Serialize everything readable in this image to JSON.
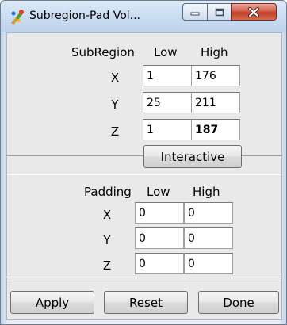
{
  "window": {
    "title": "Subregion-Pad Vol...",
    "controls": {
      "minimize": "minimize",
      "maximize": "maximize",
      "close": "close"
    }
  },
  "subregion": {
    "heading": "SubRegion",
    "low_label": "Low",
    "high_label": "High",
    "rows": [
      {
        "axis": "X",
        "low": "1",
        "high": "176"
      },
      {
        "axis": "Y",
        "low": "25",
        "high": "211"
      },
      {
        "axis": "Z",
        "low": "1",
        "high": "187"
      }
    ],
    "interactive_label": "Interactive"
  },
  "padding": {
    "heading": "Padding",
    "low_label": "Low",
    "high_label": "High",
    "rows": [
      {
        "axis": "X",
        "low": "0",
        "high": "0"
      },
      {
        "axis": "Y",
        "low": "0",
        "high": "0"
      },
      {
        "axis": "Z",
        "low": "0",
        "high": "0"
      }
    ]
  },
  "actions": {
    "apply": "Apply",
    "reset": "Reset",
    "done": "Done"
  },
  "colors": {
    "titlebar": "#c9dcf1",
    "client": "#e9e9e9",
    "close": "#c2402c"
  },
  "icons": {
    "app": "paint-icon"
  }
}
